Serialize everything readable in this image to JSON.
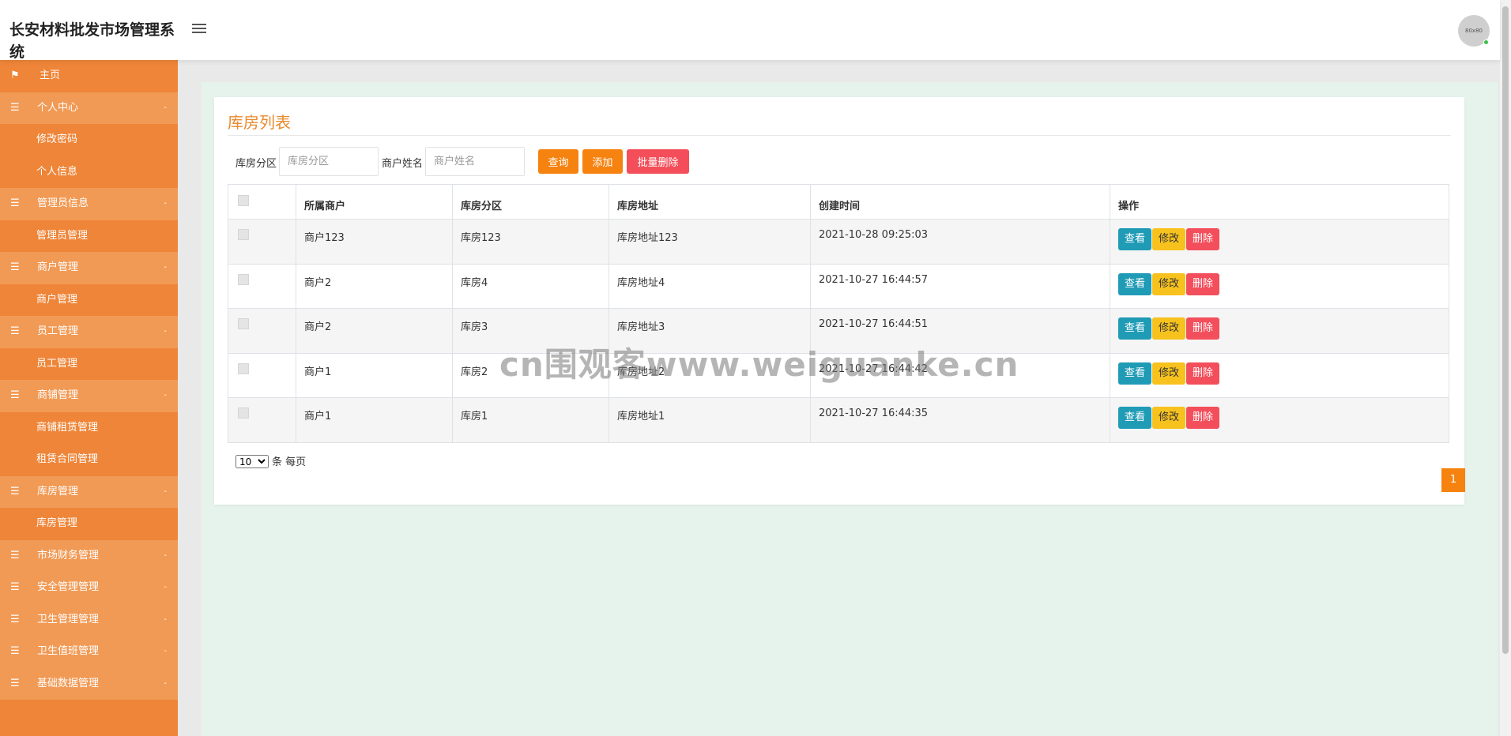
{
  "header": {
    "title": "长安材料批发市场管理系统",
    "avatar_text": "80x80"
  },
  "sidebar": {
    "items": [
      {
        "label": "主页",
        "icon": "flag-icon",
        "type": "home"
      },
      {
        "label": "个人中心",
        "icon": "list-icon",
        "type": "parent"
      },
      {
        "label": "修改密码",
        "type": "child"
      },
      {
        "label": "个人信息",
        "type": "child"
      },
      {
        "label": "管理员信息",
        "icon": "list-icon",
        "type": "parent"
      },
      {
        "label": "管理员管理",
        "type": "child"
      },
      {
        "label": "商户管理",
        "icon": "list-icon",
        "type": "parent"
      },
      {
        "label": "商户管理",
        "type": "child"
      },
      {
        "label": "员工管理",
        "icon": "list-icon",
        "type": "parent"
      },
      {
        "label": "员工管理",
        "type": "child"
      },
      {
        "label": "商铺管理",
        "icon": "list-icon",
        "type": "parent"
      },
      {
        "label": "商铺租赁管理",
        "type": "child"
      },
      {
        "label": "租赁合同管理",
        "type": "child"
      },
      {
        "label": "库房管理",
        "icon": "list-icon",
        "type": "parent"
      },
      {
        "label": "库房管理",
        "type": "child"
      },
      {
        "label": "市场财务管理",
        "icon": "list-icon",
        "type": "parent"
      },
      {
        "label": "安全管理管理",
        "icon": "list-icon",
        "type": "parent"
      },
      {
        "label": "卫生管理管理",
        "icon": "list-icon",
        "type": "parent"
      },
      {
        "label": "卫生值班管理",
        "icon": "list-icon",
        "type": "parent"
      },
      {
        "label": "基础数据管理",
        "icon": "list-icon",
        "type": "parent"
      }
    ]
  },
  "main": {
    "title": "库房列表",
    "search": {
      "zone_label": "库房分区",
      "zone_placeholder": "库房分区",
      "merchant_label": "商户姓名",
      "merchant_placeholder": "商户姓名",
      "query_label": "查询",
      "add_label": "添加",
      "batch_delete_label": "批量删除"
    },
    "table": {
      "headers": [
        "所属商户",
        "库房分区",
        "库房地址",
        "创建时间",
        "操作"
      ],
      "rows": [
        {
          "merchant": "商户123",
          "zone": "库房123",
          "address": "库房地址123",
          "created": "2021-10-28 09:25:03"
        },
        {
          "merchant": "商户2",
          "zone": "库房4",
          "address": "库房地址4",
          "created": "2021-10-27 16:44:57"
        },
        {
          "merchant": "商户2",
          "zone": "库房3",
          "address": "库房地址3",
          "created": "2021-10-27 16:44:51"
        },
        {
          "merchant": "商户1",
          "zone": "库房2",
          "address": "库房地址2",
          "created": "2021-10-27 16:44:42"
        },
        {
          "merchant": "商户1",
          "zone": "库房1",
          "address": "库房地址1",
          "created": "2021-10-27 16:44:35"
        }
      ],
      "actions": {
        "view": "查看",
        "edit": "修改",
        "delete": "删除"
      }
    },
    "pagination": {
      "page_size": "10",
      "per_page_label": "条 每页",
      "current_page": "1"
    }
  },
  "watermark": "cn围观客www.weiguanke.cn",
  "colors": {
    "sidebar": "#ee8538",
    "sidebar_parent": "#f19a55",
    "accent": "#f6820f",
    "danger": "#f44e5a",
    "view": "#1f9bb6",
    "edit": "#f7c21e",
    "content_bg": "#e6f3ec"
  }
}
